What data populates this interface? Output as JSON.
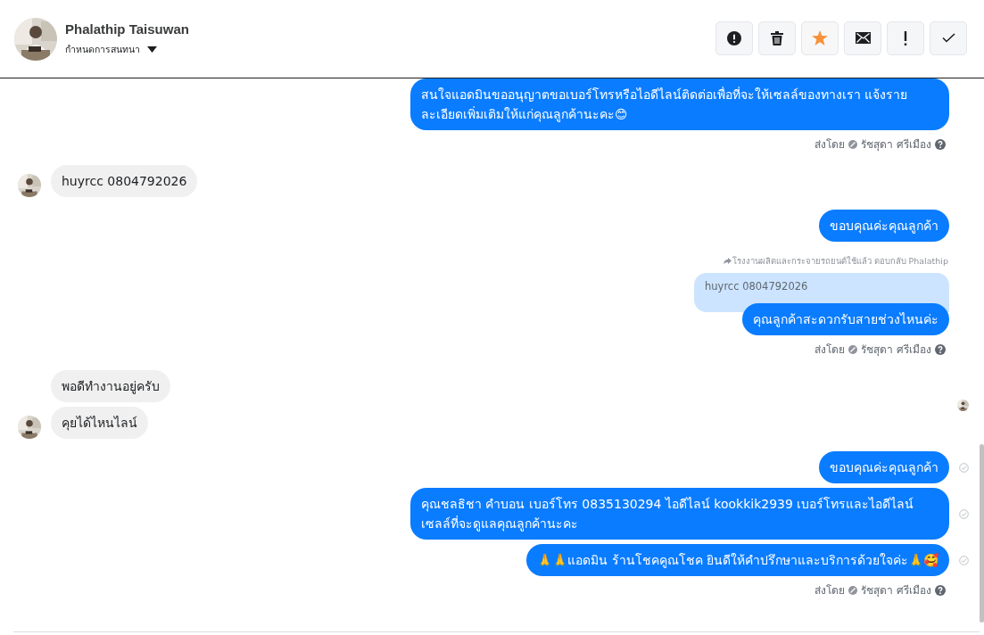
{
  "header": {
    "name": "Phalathip Taisuwan",
    "subtitle": "กำหนดการสนทนา"
  },
  "toolbar": [
    {
      "kind": "alert"
    },
    {
      "kind": "delete"
    },
    {
      "kind": "star",
      "on": true
    },
    {
      "kind": "mail"
    },
    {
      "kind": "important"
    },
    {
      "kind": "done"
    }
  ],
  "messages": [
    {
      "kind": "out",
      "text": "สนใจแอดมินขออนุญาตขอเบอร์โทรหรือไอดีไลน์ติดต่อเพื่อที่จะให้เซลล์ของทางเรา แจ้งรายละเอียดเพิ่มเติมให้แก่คุณลูกค้านะคะ😊",
      "seen": false
    },
    {
      "kind": "sent_by",
      "label": "ส่งโดย",
      "agent": "รัชสุดา ศรีเมือง"
    },
    {
      "kind": "in",
      "text": "huyrcc 0804792026",
      "avatar": true,
      "read_marker": false
    },
    {
      "kind": "out",
      "text": "ขอบคุณค่ะคุณลูกค้า",
      "seen": false
    },
    {
      "kind": "reply_note",
      "text": "โรงงานผลิตและกระจายรถยนต์ใช้แล้ว ตอบกลับ Phalathip"
    },
    {
      "kind": "quote",
      "text": "huyrcc 0804792026"
    },
    {
      "kind": "out",
      "text": "คุณลูกค้าสะดวกรับสายช่วงไหนค่ะ",
      "seen": false
    },
    {
      "kind": "sent_by",
      "label": "ส่งโดย",
      "agent": "รัชสุดา ศรีเมือง"
    },
    {
      "kind": "in",
      "text": "พอดีทำงานอยู่ครับ",
      "avatar": false,
      "read_marker": true
    },
    {
      "kind": "in",
      "text": "คุยได้ไหนไลน์",
      "avatar": true,
      "read_marker": false
    },
    {
      "kind": "out",
      "text": "ขอบคุณค่ะคุณลูกค้า",
      "seen": true
    },
    {
      "kind": "out",
      "text": "คุณชลธิชา คำบอน  เบอร์โทร 0835130294  ไอดีไลน์ kookkik2939   เบอร์โทรและไอดีไลน์เซลล์ที่จะดูแลคุณลูกค้านะคะ",
      "seen": true
    },
    {
      "kind": "out",
      "text": "🙏🙏แอดมิน ร้านโชคคูณโชค ยินดีให้คำปรึกษาและบริการด้วยใจค่ะ🙏🥰",
      "seen": true
    },
    {
      "kind": "sent_by",
      "label": "ส่งโดย",
      "agent": "รัชสุดา ศรีเมือง"
    }
  ]
}
